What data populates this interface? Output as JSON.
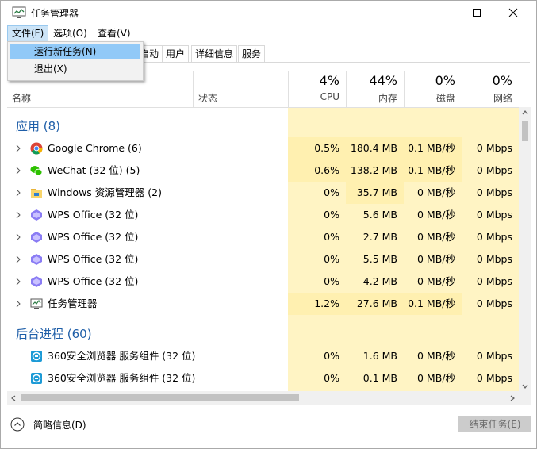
{
  "window": {
    "title": "任务管理器"
  },
  "menu": [
    "文件(F)",
    "选项(O)",
    "查看(V)"
  ],
  "file_menu": {
    "items": [
      "运行新任务(N)",
      "退出(X)"
    ]
  },
  "tabs": [
    "启动",
    "用户",
    "详细信息",
    "服务"
  ],
  "columns": {
    "name": "名称",
    "status": "状态",
    "cpu": {
      "pct": "4%",
      "label": "CPU"
    },
    "memory": {
      "pct": "44%",
      "label": "内存"
    },
    "disk": {
      "pct": "0%",
      "label": "磁盘"
    },
    "network": {
      "pct": "0%",
      "label": "网络"
    }
  },
  "groups": {
    "apps": "应用 (8)",
    "background": "后台进程 (60)"
  },
  "rows": [
    {
      "name": "Google Chrome (6)",
      "icon": "chrome-icon",
      "cpu": "0.5%",
      "mem": "180.4 MB",
      "disk": "0.1 MB/秒",
      "net": "0 Mbps"
    },
    {
      "name": "WeChat (32 位) (5)",
      "icon": "wechat-icon",
      "cpu": "0.6%",
      "mem": "138.2 MB",
      "disk": "0.1 MB/秒",
      "net": "0 Mbps"
    },
    {
      "name": "Windows 资源管理器 (2)",
      "icon": "folder-icon",
      "cpu": "0%",
      "mem": "35.7 MB",
      "disk": "0 MB/秒",
      "net": "0 Mbps"
    },
    {
      "name": "WPS Office (32 位)",
      "icon": "wps-icon",
      "cpu": "0%",
      "mem": "5.6 MB",
      "disk": "0 MB/秒",
      "net": "0 Mbps"
    },
    {
      "name": "WPS Office (32 位)",
      "icon": "wps-icon",
      "cpu": "0%",
      "mem": "2.7 MB",
      "disk": "0 MB/秒",
      "net": "0 Mbps"
    },
    {
      "name": "WPS Office (32 位)",
      "icon": "wps-icon",
      "cpu": "0%",
      "mem": "5.5 MB",
      "disk": "0 MB/秒",
      "net": "0 Mbps"
    },
    {
      "name": "WPS Office (32 位)",
      "icon": "wps-icon",
      "cpu": "0%",
      "mem": "4.2 MB",
      "disk": "0 MB/秒",
      "net": "0 Mbps"
    },
    {
      "name": "任务管理器",
      "icon": "task-manager-icon",
      "cpu": "1.2%",
      "mem": "27.6 MB",
      "disk": "0.1 MB/秒",
      "net": "0 Mbps"
    }
  ],
  "bg_rows": [
    {
      "name": "360安全浏览器 服务组件 (32 位)",
      "icon": "360-browser-icon",
      "cpu": "0%",
      "mem": "1.6 MB",
      "disk": "0 MB/秒",
      "net": "0 Mbps"
    },
    {
      "name": "360安全浏览器 服务组件 (32 位)",
      "icon": "360-browser-icon",
      "cpu": "0%",
      "mem": "0.1 MB",
      "disk": "0 MB/秒",
      "net": "0 Mbps"
    }
  ],
  "footer": {
    "fewer_details": "简略信息(D)",
    "end_task": "结束任务(E)"
  },
  "colors": {
    "accent": "#1e5ea8",
    "heat_light": "#fff4c4",
    "heat_medium": "#fff0b0",
    "menu_highlight": "#91c9f7"
  }
}
